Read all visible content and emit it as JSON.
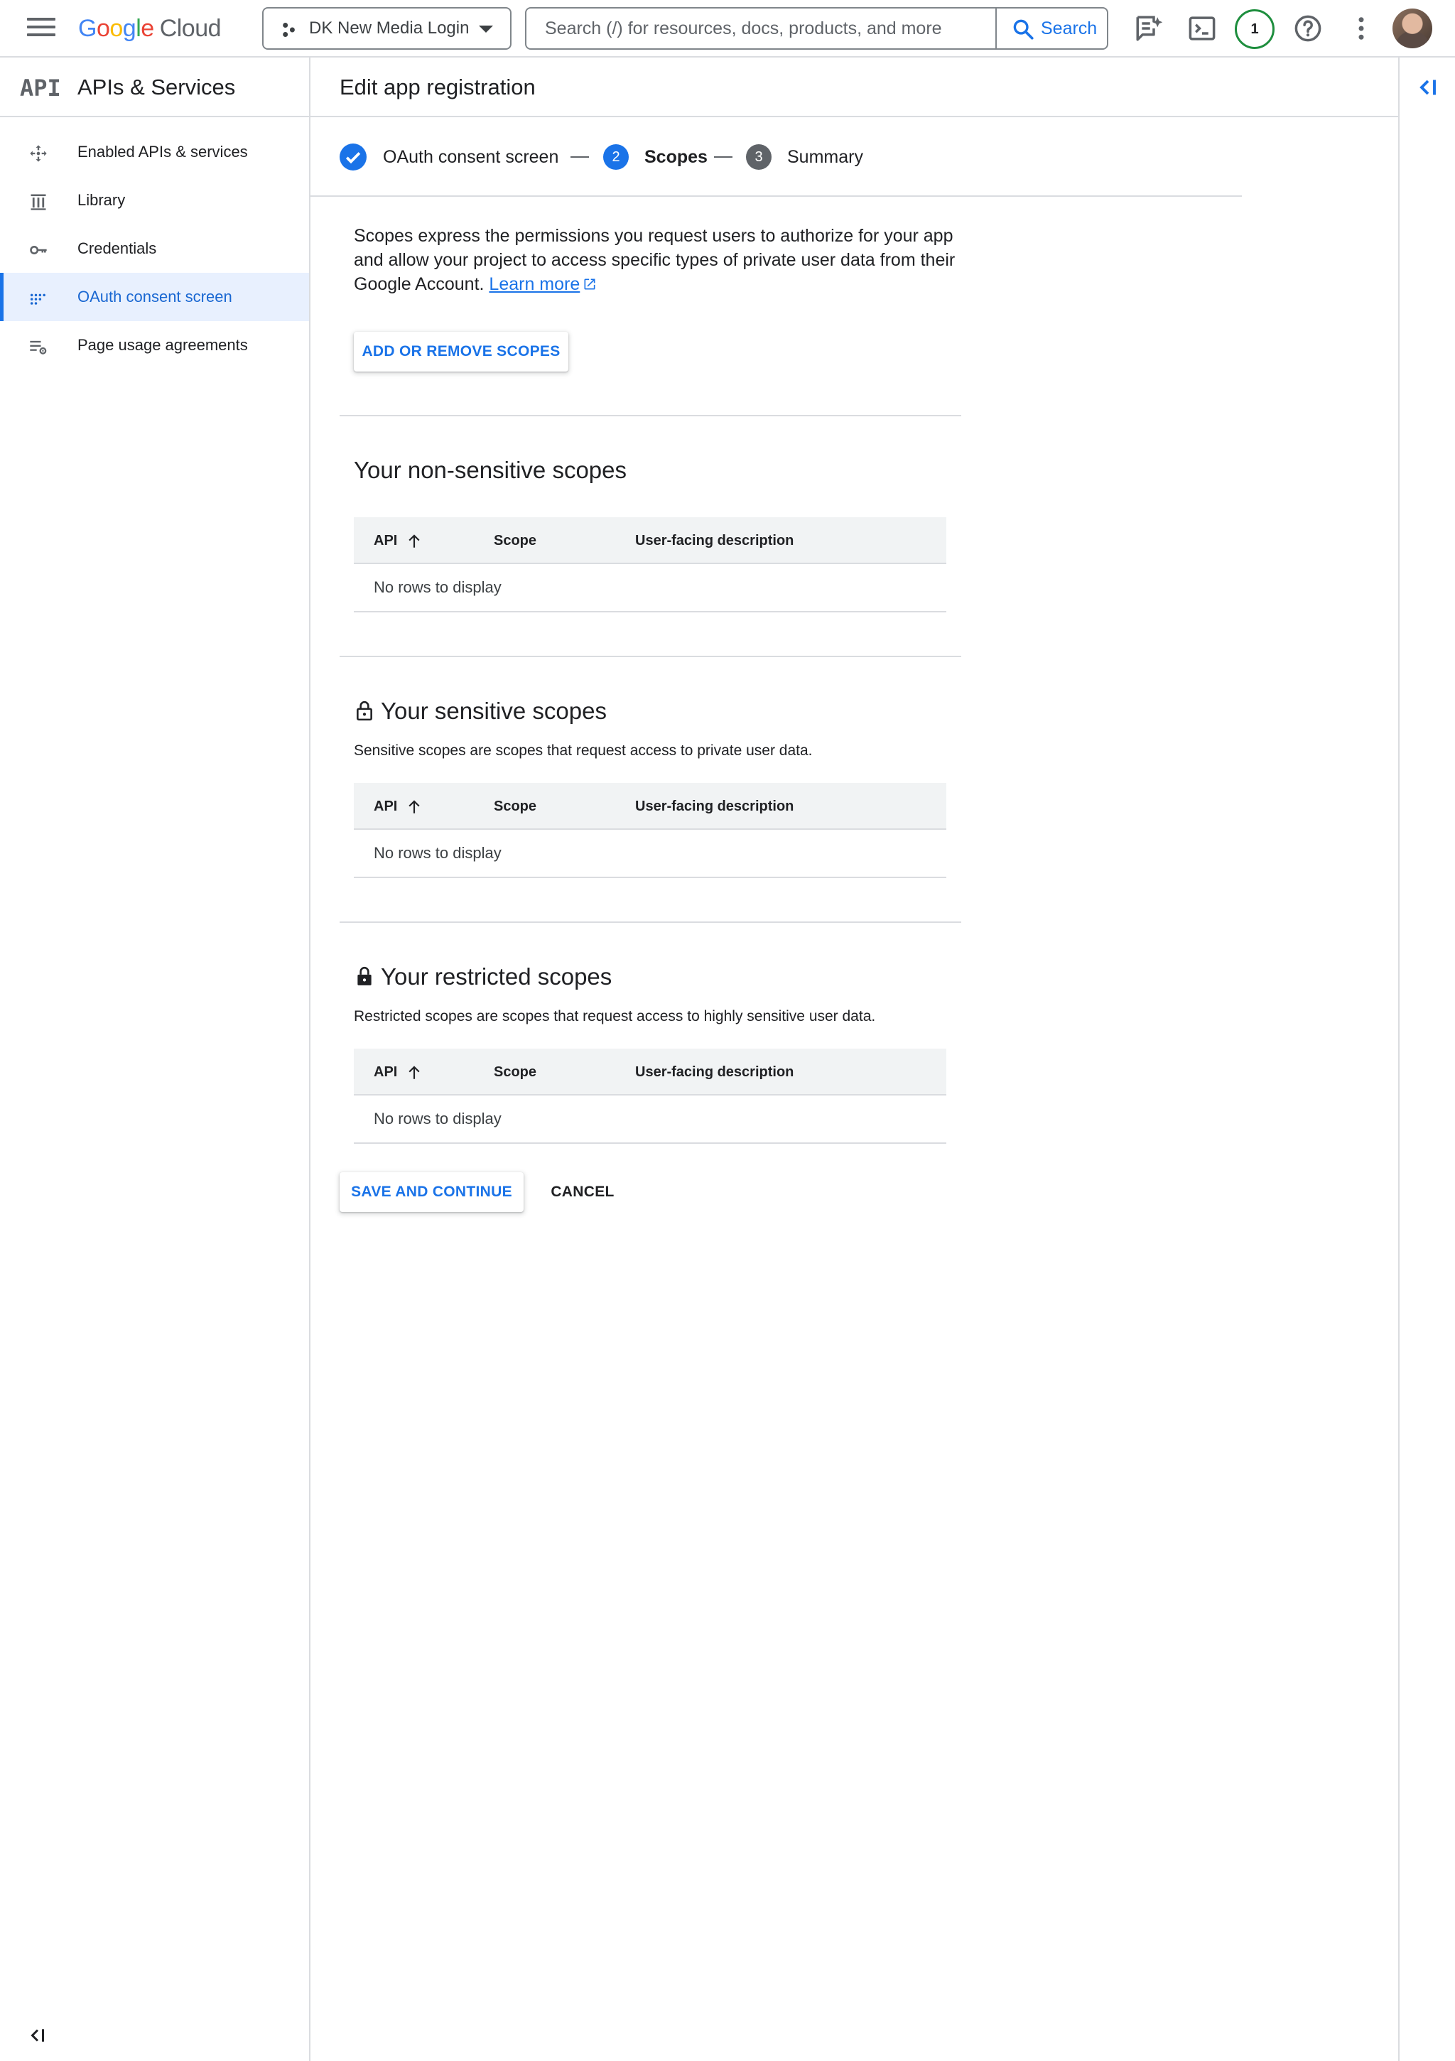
{
  "topbar": {
    "logo_g": "G",
    "logo_o1": "o",
    "logo_o2": "o",
    "logo_g2": "g",
    "logo_l": "l",
    "logo_e": "e",
    "logo_cloud": "Cloud",
    "project_name": "DK New Media Login",
    "search_placeholder": "Search (/) for resources, docs, products, and more",
    "search_button": "Search",
    "notification_count": "1"
  },
  "sidebar": {
    "title": "APIs & Services",
    "api_logo": "API",
    "items": [
      {
        "label": "Enabled APIs & services",
        "icon": "move-icon",
        "active": false
      },
      {
        "label": "Library",
        "icon": "library-icon",
        "active": false
      },
      {
        "label": "Credentials",
        "icon": "key-icon",
        "active": false
      },
      {
        "label": "OAuth consent screen",
        "icon": "consent-grid-icon",
        "active": true
      },
      {
        "label": "Page usage agreements",
        "icon": "list-settings-icon",
        "active": false
      }
    ]
  },
  "page": {
    "title": "Edit app registration"
  },
  "stepper": {
    "steps": [
      {
        "number": "",
        "label": "OAuth consent screen",
        "state": "done"
      },
      {
        "number": "2",
        "label": "Scopes",
        "state": "current"
      },
      {
        "number": "3",
        "label": "Summary",
        "state": "upcoming"
      }
    ]
  },
  "intro": {
    "text": "Scopes express the permissions you request users to authorize for your app and allow your project to access specific types of private user data from their Google Account.",
    "learn_more": "Learn more"
  },
  "add_remove_button": "ADD OR REMOVE SCOPES",
  "sections": [
    {
      "title": "Your non-sensitive scopes",
      "description": "",
      "columns": [
        "API",
        "Scope",
        "User-facing description"
      ],
      "empty_text": "No rows to display"
    },
    {
      "title": "Your sensitive scopes",
      "description": "Sensitive scopes are scopes that request access to private user data.",
      "columns": [
        "API",
        "Scope",
        "User-facing description"
      ],
      "empty_text": "No rows to display"
    },
    {
      "title": "Your restricted scopes",
      "description": "Restricted scopes are scopes that request access to highly sensitive user data.",
      "columns": [
        "API",
        "Scope",
        "User-facing description"
      ],
      "empty_text": "No rows to display"
    }
  ],
  "actions": {
    "save": "SAVE AND CONTINUE",
    "cancel": "CANCEL"
  },
  "colors": {
    "accent": "#1a73e8",
    "active_bg": "#e8f0fe",
    "border": "#dadce0",
    "notification_ring": "#1e8e3e"
  }
}
